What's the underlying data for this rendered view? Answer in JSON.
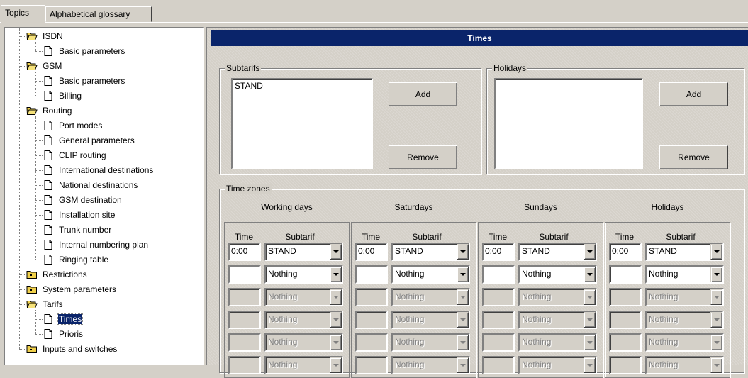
{
  "tabs": [
    {
      "label": "Topics"
    },
    {
      "label": "Alphabetical glossary"
    }
  ],
  "tree": [
    {
      "label": "ISDN",
      "icon": "open-folder-icon",
      "level": 0
    },
    {
      "label": "Basic parameters",
      "icon": "page-icon",
      "level": 1
    },
    {
      "label": "GSM",
      "icon": "open-folder-icon",
      "level": 0
    },
    {
      "label": "Basic parameters",
      "icon": "page-icon",
      "level": 1
    },
    {
      "label": "Billing",
      "icon": "page-icon",
      "level": 1
    },
    {
      "label": "Routing",
      "icon": "open-folder-icon",
      "level": 0
    },
    {
      "label": "Port modes",
      "icon": "page-icon",
      "level": 1
    },
    {
      "label": "General parameters",
      "icon": "page-icon",
      "level": 1
    },
    {
      "label": "CLIP routing",
      "icon": "page-icon",
      "level": 1
    },
    {
      "label": "International destinations",
      "icon": "page-icon",
      "level": 1
    },
    {
      "label": "National destinations",
      "icon": "page-icon",
      "level": 1
    },
    {
      "label": "GSM destination",
      "icon": "page-icon",
      "level": 1
    },
    {
      "label": "Installation site",
      "icon": "page-icon",
      "level": 1
    },
    {
      "label": "Trunk number",
      "icon": "page-icon",
      "level": 1
    },
    {
      "label": "Internal numbering plan",
      "icon": "page-icon",
      "level": 1
    },
    {
      "label": "Ringing table",
      "icon": "page-icon",
      "level": 1
    },
    {
      "label": "Restrictions",
      "icon": "closed-folder-icon",
      "level": 0
    },
    {
      "label": "System parameters",
      "icon": "closed-folder-icon",
      "level": 0
    },
    {
      "label": "Tarifs",
      "icon": "open-folder-icon",
      "level": 0
    },
    {
      "label": "Times",
      "icon": "page-icon",
      "level": 1,
      "selected": true
    },
    {
      "label": "Prioris",
      "icon": "page-icon",
      "level": 1
    },
    {
      "label": "Inputs and switches",
      "icon": "closed-folder-icon",
      "level": 0
    }
  ],
  "pane": {
    "title": "Times",
    "subtarifs": {
      "legend": "Subtarifs",
      "items": [
        "STAND"
      ],
      "add_label": "Add",
      "remove_label": "Remove"
    },
    "holidays": {
      "legend": "Holidays",
      "items": [],
      "add_label": "Add",
      "remove_label": "Remove"
    },
    "time_zones": {
      "legend": "Time zones",
      "time_header": "Time",
      "subtarif_header": "Subtarif",
      "columns": [
        {
          "title": "Working days",
          "rows": [
            {
              "time": "0:00",
              "subtarif": "STAND",
              "enabled": true
            },
            {
              "time": "",
              "subtarif": "Nothing",
              "enabled": true
            },
            {
              "time": "",
              "subtarif": "Nothing",
              "enabled": false
            },
            {
              "time": "",
              "subtarif": "Nothing",
              "enabled": false
            },
            {
              "time": "",
              "subtarif": "Nothing",
              "enabled": false
            },
            {
              "time": "",
              "subtarif": "Nothing",
              "enabled": false
            }
          ]
        },
        {
          "title": "Saturdays",
          "rows": [
            {
              "time": "0:00",
              "subtarif": "STAND",
              "enabled": true
            },
            {
              "time": "",
              "subtarif": "Nothing",
              "enabled": true
            },
            {
              "time": "",
              "subtarif": "Nothing",
              "enabled": false
            },
            {
              "time": "",
              "subtarif": "Nothing",
              "enabled": false
            },
            {
              "time": "",
              "subtarif": "Nothing",
              "enabled": false
            },
            {
              "time": "",
              "subtarif": "Nothing",
              "enabled": false
            }
          ]
        },
        {
          "title": "Sundays",
          "rows": [
            {
              "time": "0:00",
              "subtarif": "STAND",
              "enabled": true
            },
            {
              "time": "",
              "subtarif": "Nothing",
              "enabled": true
            },
            {
              "time": "",
              "subtarif": "Nothing",
              "enabled": false
            },
            {
              "time": "",
              "subtarif": "Nothing",
              "enabled": false
            },
            {
              "time": "",
              "subtarif": "Nothing",
              "enabled": false
            },
            {
              "time": "",
              "subtarif": "Nothing",
              "enabled": false
            }
          ]
        },
        {
          "title": "Holidays",
          "rows": [
            {
              "time": "0:00",
              "subtarif": "STAND",
              "enabled": true
            },
            {
              "time": "",
              "subtarif": "Nothing",
              "enabled": true
            },
            {
              "time": "",
              "subtarif": "Nothing",
              "enabled": false
            },
            {
              "time": "",
              "subtarif": "Nothing",
              "enabled": false
            },
            {
              "time": "",
              "subtarif": "Nothing",
              "enabled": false
            },
            {
              "time": "",
              "subtarif": "Nothing",
              "enabled": false
            }
          ]
        }
      ]
    }
  },
  "colors": {
    "title_bar": "#0a246a",
    "face": "#d4d0c8",
    "folder": "#f0d04a"
  }
}
